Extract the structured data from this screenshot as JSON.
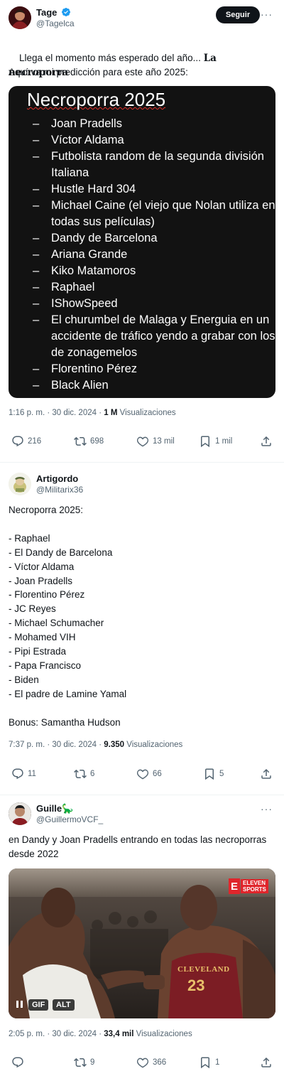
{
  "post1": {
    "name": "Tage",
    "handle": "@Tagelca",
    "follow_label": "Seguir",
    "more": "···",
    "text_line1": "Llega el momento más esperado del año... ",
    "text_bold": "La necroporra",
    "text_line2": "Aquí va mi predicción para este año 2025:",
    "card": {
      "title": "Necroporra 2025",
      "items": [
        "Joan Pradells",
        "Víctor Aldama",
        "Futbolista random de la segunda división Italiana",
        "Hustle Hard 304",
        "Michael Caine (el viejo que Nolan utiliza en todas sus películas)",
        "Dandy de Barcelona",
        "Ariana Grande",
        "Kiko Matamoros",
        "Raphael",
        "IShowSpeed",
        "El churumbel de Malaga y Energuia en un accidente de tráfico yendo a grabar con los de zonagemelos",
        "Florentino Pérez",
        "Black Alien"
      ]
    },
    "time": "1:16 p. m. · 30 dic. 2024 · ",
    "views_count": "1 M",
    "views_label": " Visualizaciones",
    "replies": "216",
    "reposts": "698",
    "likes": "13 mil",
    "bookmarks": "1 mil"
  },
  "post2": {
    "name": "Artigordo",
    "handle": "@Militarix36",
    "text": "Necroporra 2025:\n\n- Raphael\n- El Dandy de Barcelona\n- Víctor Aldama\n- Joan Pradells\n- Florentino Pérez\n- JC Reyes\n- Michael Schumacher\n- Mohamed VIH\n- Pipi Estrada\n- Papa Francisco\n- Biden\n- El padre de Lamine Yamal\n\nBonus: Samantha Hudson",
    "time": "7:37 p. m. · 30 dic. 2024 · ",
    "views_count": "9.350",
    "views_label": " Visualizaciones",
    "replies": "11",
    "reposts": "6",
    "likes": "66",
    "bookmarks": "5"
  },
  "post3": {
    "name": "Guille🦕",
    "handle": "@GuillermoVCF_",
    "more": "···",
    "text": "en Dandy y Joan Pradells entrando en todas las necroporras desde 2022",
    "video": {
      "gif_label": "GIF",
      "alt_label": "ALT",
      "brand_top": "ELEVEN",
      "brand_bottom": "SPORTS",
      "jersey_text": "CLEVELAND",
      "jersey_number": "23"
    },
    "time": "2:05 p. m. · 30 dic. 2024 · ",
    "views_count": "33,4 mil",
    "views_label": " Visualizaciones",
    "replies": "",
    "reposts": "9",
    "likes": "366",
    "bookmarks": "1"
  },
  "colors": {
    "verified": "#1d9bf0",
    "text_secondary": "#536471",
    "card_bg": "#121212",
    "brand_red": "#e0252b"
  }
}
